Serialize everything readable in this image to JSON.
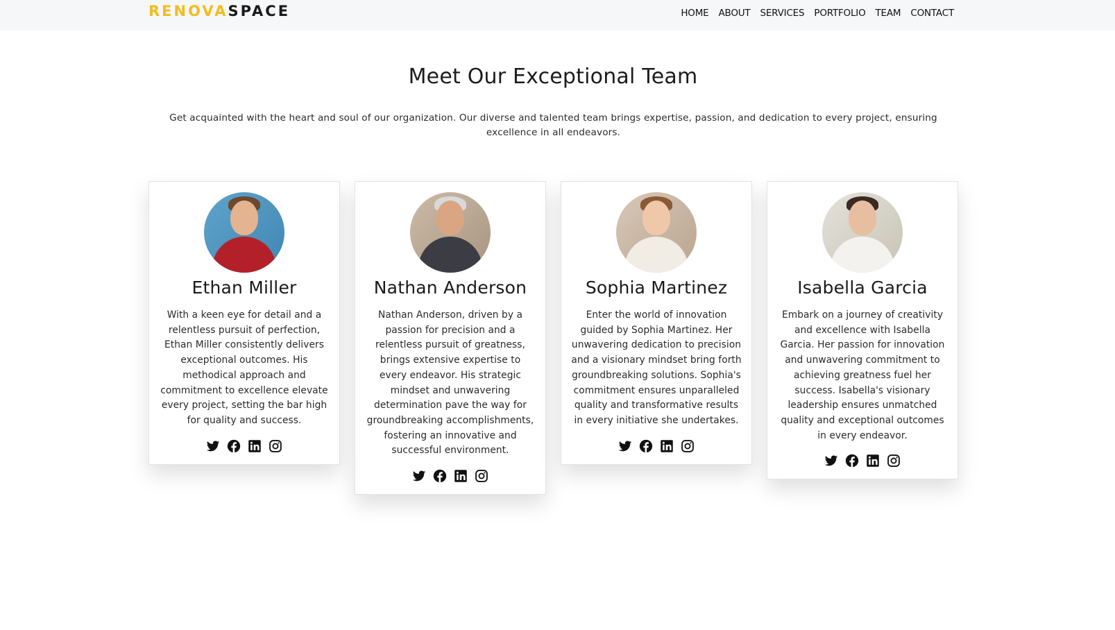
{
  "brand": {
    "part1": "RENOVA",
    "part2": "SPACE"
  },
  "nav": [
    "HOME",
    "ABOUT",
    "SERVICES",
    "PORTFOLIO",
    "TEAM",
    "CONTACT"
  ],
  "section": {
    "title": "Meet Our Exceptional Team",
    "subtitle": "Get acquainted with the heart and soul of our organization. Our diverse and talented team brings expertise, passion, and dedication to every project, ensuring excellence in all endeavors."
  },
  "team": [
    {
      "name": "Ethan Miller",
      "bio": "With a keen eye for detail and a relentless pursuit of perfection, Ethan Miller consistently delivers exceptional outcomes. His methodical approach and commitment to excellence elevate every project, setting the bar high for quality and success."
    },
    {
      "name": "Nathan Anderson",
      "bio": "Nathan Anderson, driven by a passion for precision and a relentless pursuit of greatness, brings extensive expertise to every endeavor. His strategic mindset and unwavering determination pave the way for groundbreaking accomplishments, fostering an innovative and successful environment."
    },
    {
      "name": "Sophia Martinez",
      "bio": "Enter the world of innovation guided by Sophia Martinez. Her unwavering dedication to precision and a visionary mindset bring forth groundbreaking solutions. Sophia's commitment ensures unparalleled quality and transformative results in every initiative she undertakes."
    },
    {
      "name": "Isabella Garcia",
      "bio": "Embark on a journey of creativity and excellence with Isabella Garcia. Her passion for innovation and unwavering commitment to achieving greatness fuel her success. Isabella's visionary leadership ensures unmatched quality and exceptional outcomes in every endeavor."
    }
  ],
  "social_icons": [
    "twitter-icon",
    "facebook-icon",
    "linkedin-icon",
    "instagram-icon"
  ],
  "colors": {
    "brand_accent": "#f5bc1c",
    "navbar_bg": "#f6f7f9",
    "text": "#1a1a1a"
  }
}
